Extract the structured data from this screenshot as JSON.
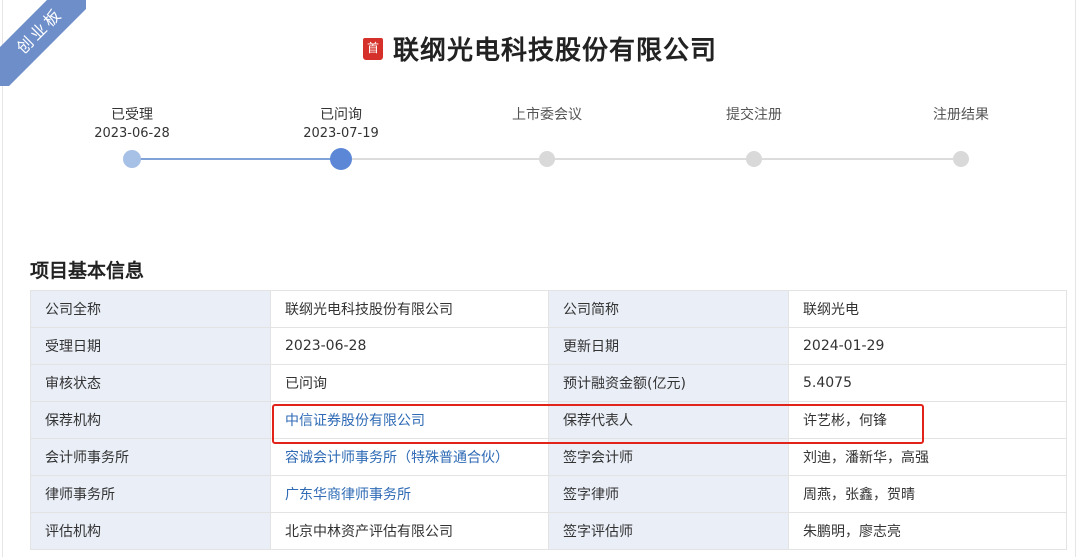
{
  "board_label": "创业板",
  "header": {
    "badge": "首",
    "company_title": "联纲光电科技股份有限公司"
  },
  "progress": [
    {
      "label": "已受理",
      "date": "2023-06-28",
      "status": "done"
    },
    {
      "label": "已问询",
      "date": "2023-07-19",
      "status": "current"
    },
    {
      "label": "上市委会议",
      "date": "",
      "status": "pending"
    },
    {
      "label": "提交注册",
      "date": "",
      "status": "pending"
    },
    {
      "label": "注册结果",
      "date": "",
      "status": "pending"
    }
  ],
  "section_title": "项目基本信息",
  "rows": [
    {
      "k1": "公司全称",
      "v1": "联纲光电科技股份有限公司",
      "k2": "公司简称",
      "v2": "联纲光电"
    },
    {
      "k1": "受理日期",
      "v1": "2023-06-28",
      "k2": "更新日期",
      "v2": "2024-01-29"
    },
    {
      "k1": "审核状态",
      "v1": "已问询",
      "k2": "预计融资金额(亿元)",
      "v2": "5.4075"
    },
    {
      "k1": "保荐机构",
      "v1": "中信证券股份有限公司",
      "k2": "保荐代表人",
      "v2": "许艺彬，何锋"
    },
    {
      "k1": "会计师事务所",
      "v1": "容诚会计师事务所（特殊普通合伙）",
      "k2": "签字会计师",
      "v2": "刘迪，潘新华，高强"
    },
    {
      "k1": "律师事务所",
      "v1": "广东华商律师事务所",
      "k2": "签字律师",
      "v2": "周燕，张鑫，贺晴"
    },
    {
      "k1": "评估机构",
      "v1": "北京中林资产评估有限公司",
      "k2": "签字评估师",
      "v2": "朱鹏明，廖志亮"
    }
  ],
  "colors": {
    "ribbon": "#6d8ec9",
    "badge": "#d6302a",
    "link": "#2f6bb5",
    "progress_done": "#5b87d6",
    "highlight": "#e2231a"
  }
}
